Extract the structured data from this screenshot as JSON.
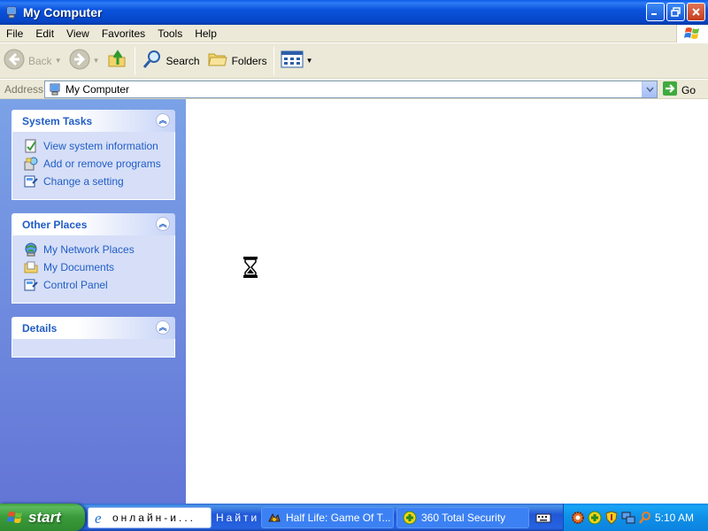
{
  "window": {
    "title": "My Computer"
  },
  "menu": [
    "File",
    "Edit",
    "View",
    "Favorites",
    "Tools",
    "Help"
  ],
  "toolbar": {
    "back_label": "Back",
    "search_label": "Search",
    "folders_label": "Folders"
  },
  "address": {
    "label": "Address",
    "value": "My Computer",
    "go_label": "Go"
  },
  "taskpane": {
    "system_tasks": {
      "title": "System Tasks",
      "items": [
        "View system information",
        "Add or remove programs",
        "Change a setting"
      ]
    },
    "other_places": {
      "title": "Other Places",
      "items": [
        "My Network Places",
        "My Documents",
        "Control Panel"
      ]
    },
    "details": {
      "title": "Details"
    }
  },
  "taskbar": {
    "start_label": "start",
    "ie_text": "онлайн-и...",
    "find_text": "Найти",
    "half_life_label": "Half Life: Game Of T...",
    "security_label": "360 Total Security",
    "clock": "5:10 AM"
  },
  "colors": {
    "title_blue": "#0a52dc",
    "pane_blue": "#6f8ee0",
    "link_blue": "#215dc6",
    "taskbar_blue": "#2157d7",
    "start_green": "#3a9a3a"
  }
}
